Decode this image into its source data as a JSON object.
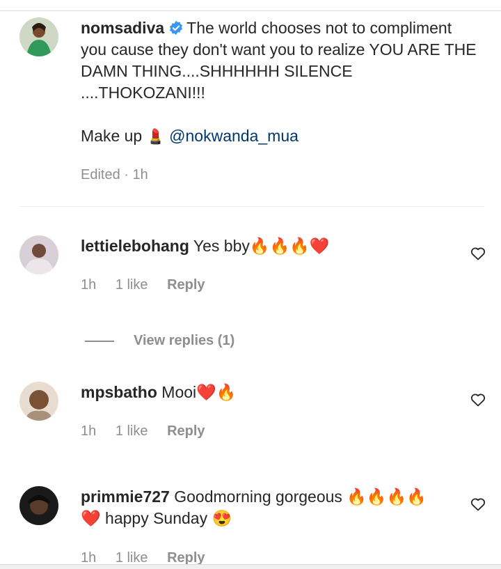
{
  "comments": [
    {
      "username": "nomsadiva",
      "text": "The world chooses not to compliment you cause they don't want you to realize YOU ARE THE DAMN THING....SHHHHHH SILENCE ....THOKOZANI!!!",
      "makeup_prefix": "Make up",
      "makeup_emoji": "💄",
      "mention": "@nokwanda_mua",
      "meta": "Edited · 1h"
    },
    {
      "username": "lettielebohang",
      "text": "Yes bby🔥🔥🔥❤️",
      "time": "1h",
      "likes": "1 like",
      "reply": "Reply"
    },
    {
      "username": "mpsbatho",
      "text": "Mooi❤️🔥",
      "time": "1h",
      "likes": "1 like",
      "reply": "Reply"
    },
    {
      "username": "primmie727",
      "text": "Goodmorning gorgeous 🔥🔥🔥🔥 ❤️ happy Sunday 😍",
      "time": "1h",
      "likes": "1 like",
      "reply": "Reply"
    }
  ],
  "view_replies": "View replies (1)",
  "colors": {
    "verified": "#3897f0",
    "mention": "#00376b",
    "meta": "#8e8e8e"
  }
}
